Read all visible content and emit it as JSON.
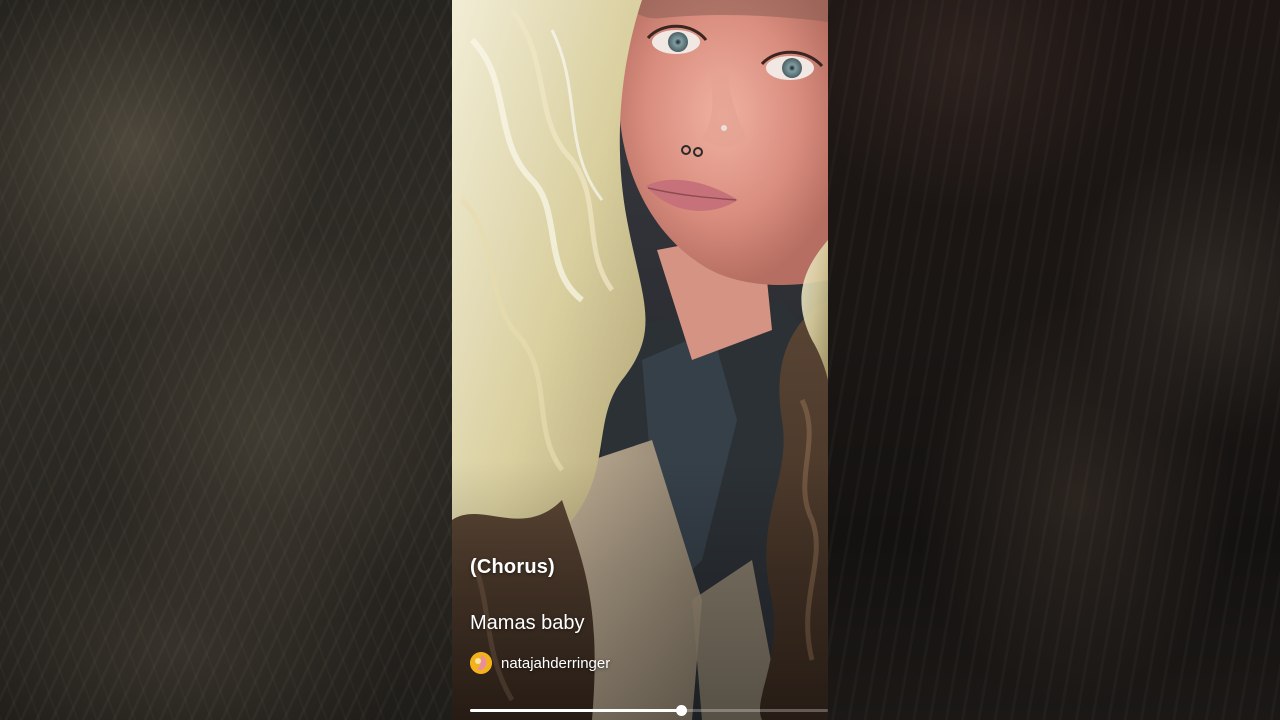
{
  "player": {
    "caption": "(Chorus)",
    "video_title": "Mamas baby",
    "channel_name": "natajahderringer",
    "progress_fraction": 0.59
  },
  "icons": {
    "avatar": "channel-avatar-icon"
  },
  "colors": {
    "progress_played": "#ffffff",
    "progress_track": "rgba(255,255,255,0.28)",
    "avatar_yellow": "#f3b21c",
    "avatar_pink": "#e88ab0"
  }
}
